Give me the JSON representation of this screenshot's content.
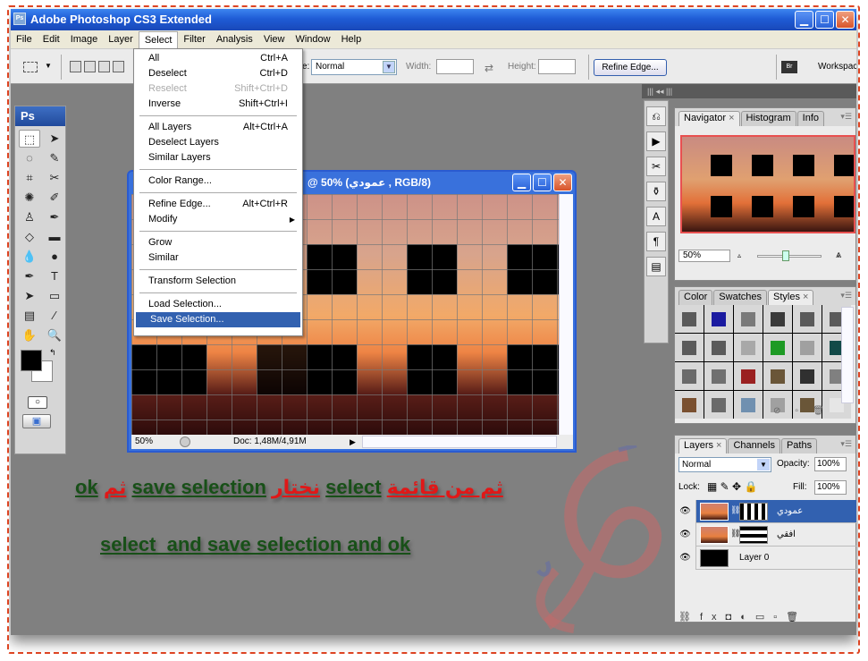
{
  "window": {
    "title": "Adobe Photoshop CS3 Extended",
    "app_icon": "Ps",
    "controls": [
      "minimize",
      "maximize",
      "close"
    ]
  },
  "menubar": [
    "File",
    "Edit",
    "Image",
    "Layer",
    "Select",
    "Filter",
    "Analysis",
    "View",
    "Window",
    "Help"
  ],
  "options_bar": {
    "style_label": "Style:",
    "style_value": "Normal",
    "width_label": "Width:",
    "height_label": "Height:",
    "refine_edge": "Refine Edge...",
    "bridge_icon": "Br",
    "workspace": "Workspace"
  },
  "select_menu": {
    "groups": [
      [
        {
          "label": "All",
          "shortcut": "Ctrl+A"
        },
        {
          "label": "Deselect",
          "shortcut": "Ctrl+D"
        },
        {
          "label": "Reselect",
          "shortcut": "Shift+Ctrl+D",
          "disabled": true
        },
        {
          "label": "Inverse",
          "shortcut": "Shift+Ctrl+I"
        }
      ],
      [
        {
          "label": "All Layers",
          "shortcut": "Alt+Ctrl+A"
        },
        {
          "label": "Deselect Layers",
          "shortcut": ""
        },
        {
          "label": "Similar Layers",
          "shortcut": ""
        }
      ],
      [
        {
          "label": "Color Range...",
          "shortcut": ""
        }
      ],
      [
        {
          "label": "Refine Edge...",
          "shortcut": "Alt+Ctrl+R"
        },
        {
          "label": "Modify",
          "shortcut": "",
          "submenu": true
        }
      ],
      [
        {
          "label": "Grow",
          "shortcut": ""
        },
        {
          "label": "Similar",
          "shortcut": ""
        }
      ],
      [
        {
          "label": "Transform Selection",
          "shortcut": ""
        }
      ],
      [
        {
          "label": "Load Selection...",
          "shortcut": ""
        },
        {
          "label": "Save Selection...",
          "shortcut": "",
          "highlighted": true
        }
      ]
    ]
  },
  "document": {
    "title": "@ 50% (عمودي , RGB/8)",
    "zoom": "50%",
    "doc_size": "Doc: 1,48M/4,91M"
  },
  "toolbox": {
    "logo": "Ps",
    "tools": [
      "marquee",
      "move",
      "lasso",
      "magic-wand",
      "crop",
      "slice",
      "healing",
      "brush",
      "stamp",
      "history-brush",
      "eraser",
      "gradient",
      "blur",
      "dodge",
      "pen",
      "type",
      "path-select",
      "shape",
      "notes",
      "eyedropper",
      "hand",
      "zoom"
    ],
    "tool_glyphs": [
      "⬚",
      "➤",
      "◌",
      "✎",
      "⌗",
      "✂",
      "✺",
      "✐",
      "♙",
      "✒",
      "◇",
      "▬",
      "💧",
      "●",
      "✒",
      "T",
      "➤",
      "▭",
      "▤",
      "⁄",
      "✋",
      "🔍"
    ]
  },
  "navigator_panel": {
    "tabs": [
      "Navigator",
      "Histogram",
      "Info"
    ],
    "zoom": "50%"
  },
  "styles_panel": {
    "tabs": [
      "Color",
      "Swatches",
      "Styles"
    ],
    "swatch_colors": [
      "#5a5a5a",
      "#1a1aa0",
      "#7a7a7a",
      "#3a3a3a",
      "#5a5a5a",
      "#5a5a5a",
      "#5a5a5a",
      "#5a5a5a",
      "#a8a8a8",
      "#1d9a24",
      "#a0a0a0",
      "#124a48",
      "#6a6a6a",
      "#707070",
      "#9a2020",
      "#6a5638",
      "#303030",
      "#808080",
      "#7a5030",
      "#6a6a6a",
      "#7090b0",
      "#a0a0a0",
      "#6a5638",
      "#e6e6e6"
    ]
  },
  "layers_panel": {
    "tabs": [
      "Layers",
      "Channels",
      "Paths"
    ],
    "blend_mode": "Normal",
    "opacity_label": "Opacity:",
    "opacity": "100%",
    "lock_label": "Lock:",
    "fill_label": "Fill:",
    "fill": "100%",
    "layers": [
      {
        "name": "عمودي",
        "selected": true,
        "mask": "vertical"
      },
      {
        "name": "افقي",
        "selected": false,
        "mask": "horizontal"
      },
      {
        "name": "Layer 0",
        "selected": false,
        "mask": null
      }
    ]
  },
  "captions": {
    "line1": {
      "ok": "ok",
      "then1": "ثم",
      "save_selection": "save selection",
      "choose": "نختار",
      "select": "select",
      "from_menu": "ثم من قائمة"
    },
    "line2": "select  and save selection and ok"
  },
  "colors": {
    "title_blue": "#1f5cd6",
    "menu_highlight": "#3261b0",
    "caption_green": "#185018",
    "caption_red": "#e01818",
    "frame_red": "#dd4422"
  }
}
